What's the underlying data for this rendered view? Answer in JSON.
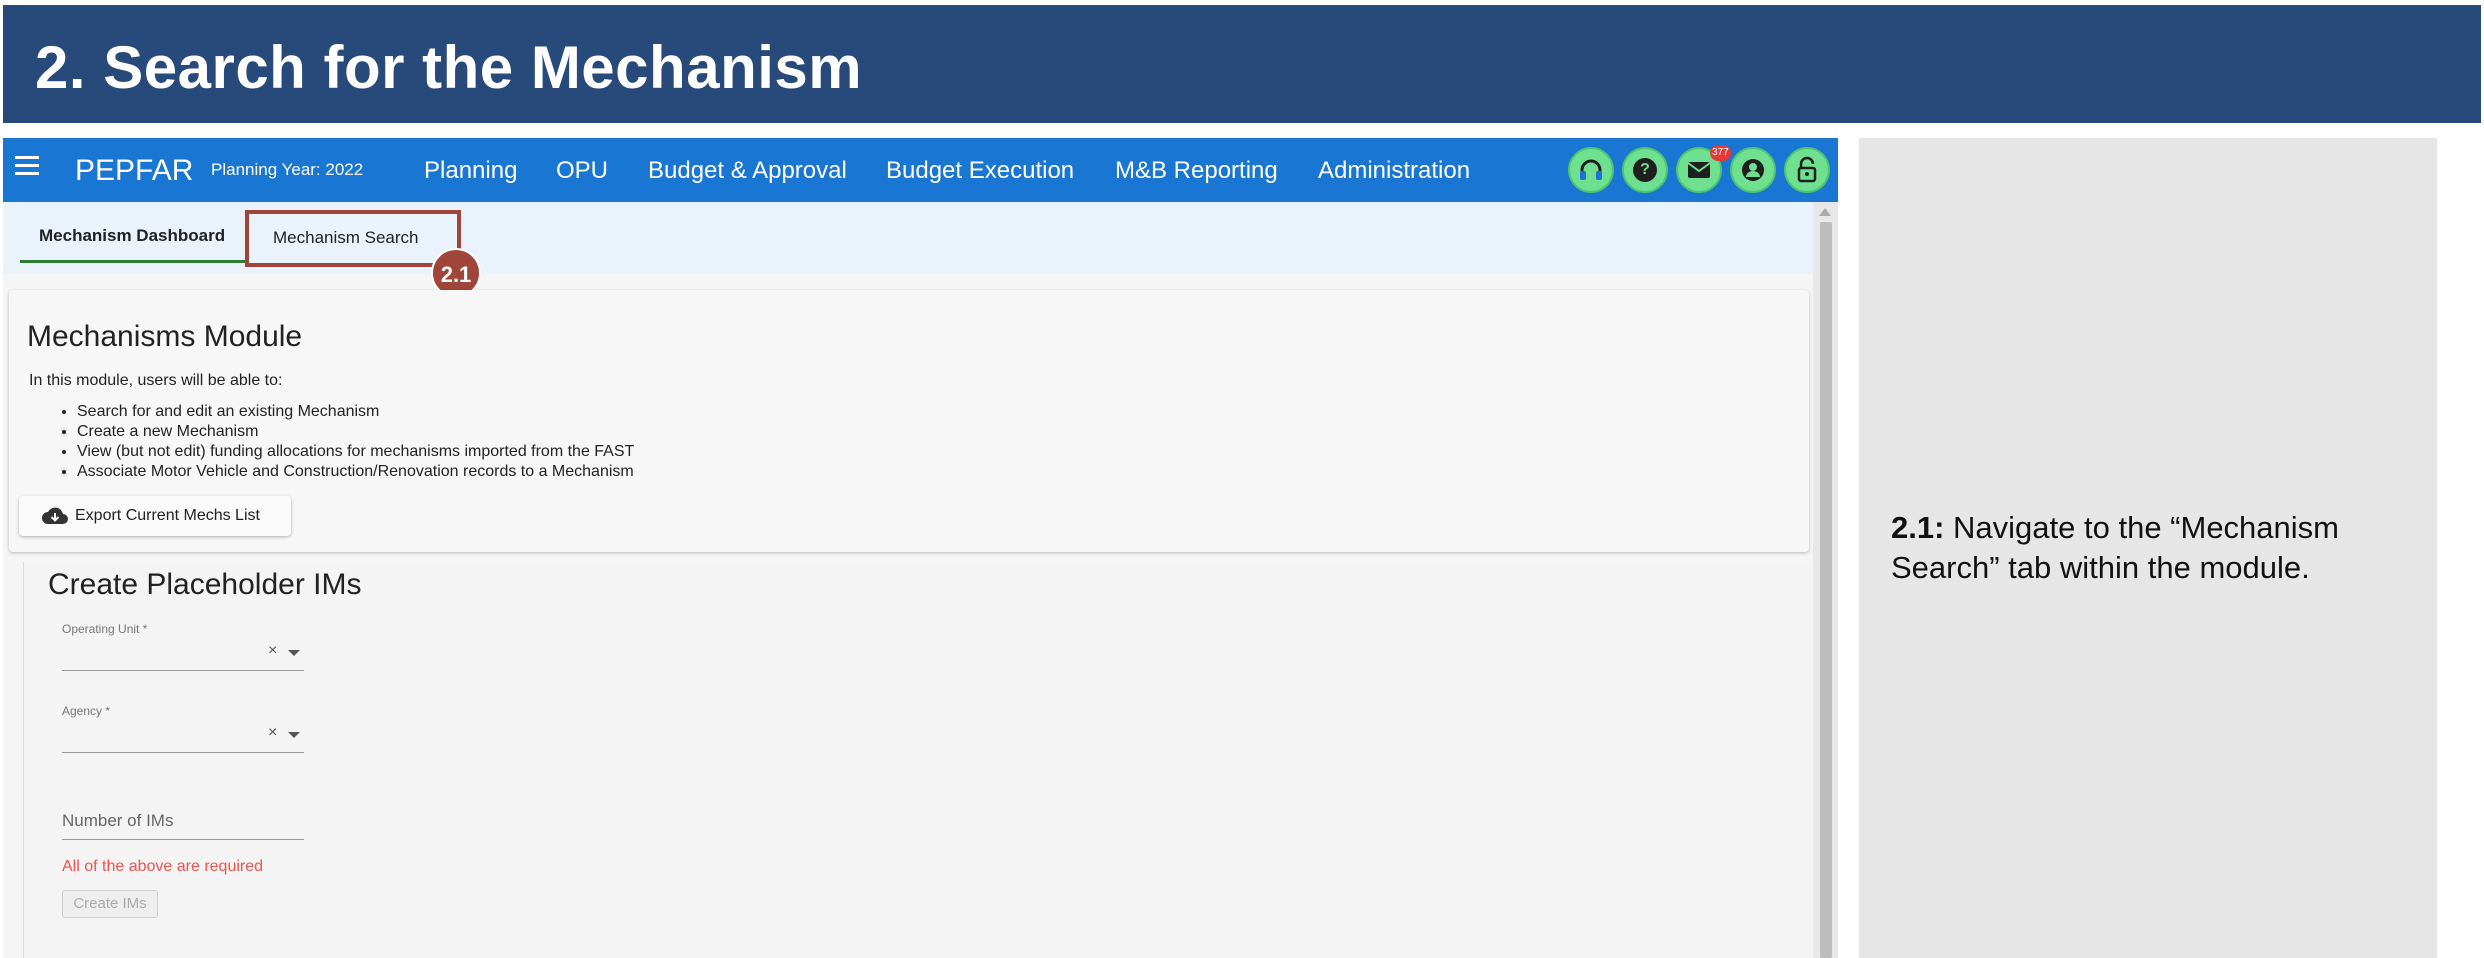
{
  "slide": {
    "title": "2. Search for the Mechanism"
  },
  "appbar": {
    "brand": "PEPFAR",
    "planning_year": "Planning Year: 2022",
    "nav": [
      "Planning",
      "OPU",
      "Budget & Approval",
      "Budget Execution",
      "M&B Reporting",
      "Administration"
    ],
    "icons": [
      "headset-icon",
      "help-icon",
      "mail-icon",
      "account-icon",
      "lock-icon"
    ],
    "mail_badge": "377"
  },
  "tabs": {
    "dashboard": "Mechanism Dashboard",
    "search": "Mechanism Search"
  },
  "callout": {
    "number": "2.1"
  },
  "module": {
    "title": "Mechanisms Module",
    "intro": "In this module, users will be able to:",
    "bullets": [
      "Search for and edit an existing Mechanism",
      "Create a new Mechanism",
      "View (but not edit) funding allocations for mechanisms imported from the FAST",
      "Associate Motor Vehicle and Construction/Renovation records to a Mechanism"
    ],
    "export_label": "Export Current Mechs List"
  },
  "placeholder": {
    "title": "Create Placeholder IMs",
    "operating_unit_label": "Operating Unit *",
    "agency_label": "Agency *",
    "clear_symbol": "×",
    "number_label": "Number of IMs",
    "error": "All of the above are required",
    "create_button": "Create IMs"
  },
  "description": {
    "step": "2.1:",
    "text": " Navigate to the “Mechanism Search” tab within the module."
  },
  "colors": {
    "title_bar": "#284a7a",
    "appbar": "#1976d2",
    "icon_bg": "#6ee08f",
    "callout": "#a0453a",
    "error": "#f0524f"
  }
}
